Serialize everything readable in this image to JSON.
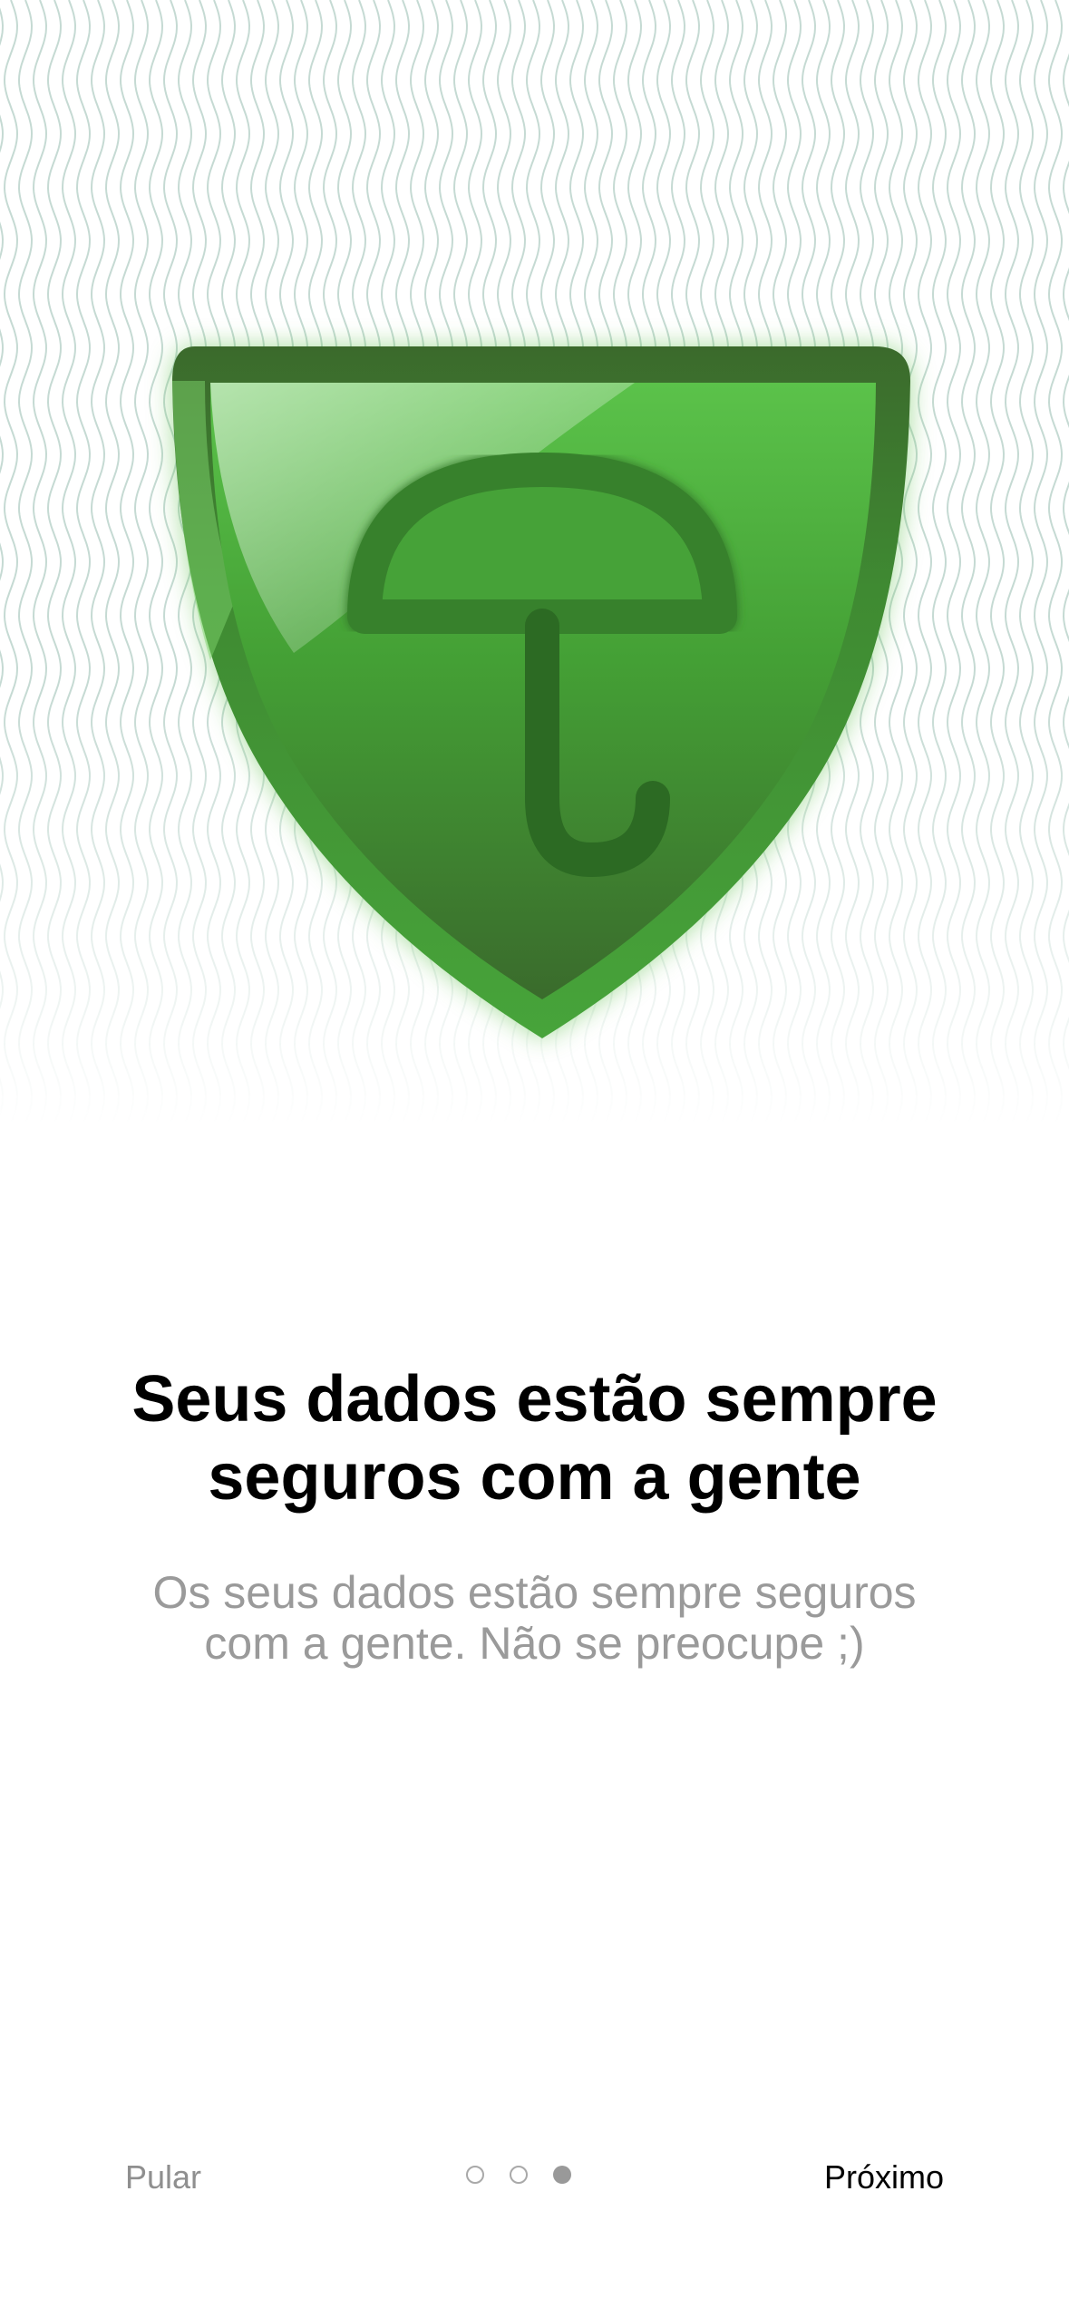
{
  "onboarding": {
    "title": "Seus dados estão sempre seguros com a gente",
    "subtitle": "Os seus dados estão sempre seguros com a gente. Não se preocupe ;)",
    "skip_label": "Pular",
    "next_label": "Próximo",
    "pagination": {
      "total": 3,
      "current": 3
    }
  },
  "illustration": {
    "icon": "shield-umbrella-icon",
    "background_pattern": "wavy-lines-pattern"
  },
  "colors": {
    "shield_green": "#4aa83b",
    "shield_dark": "#2f5e26",
    "wave_line": "#bcd4cc",
    "title": "#000000",
    "subtitle": "#9a9a9a",
    "skip": "#8f8f8f",
    "dot_active": "#999999"
  }
}
